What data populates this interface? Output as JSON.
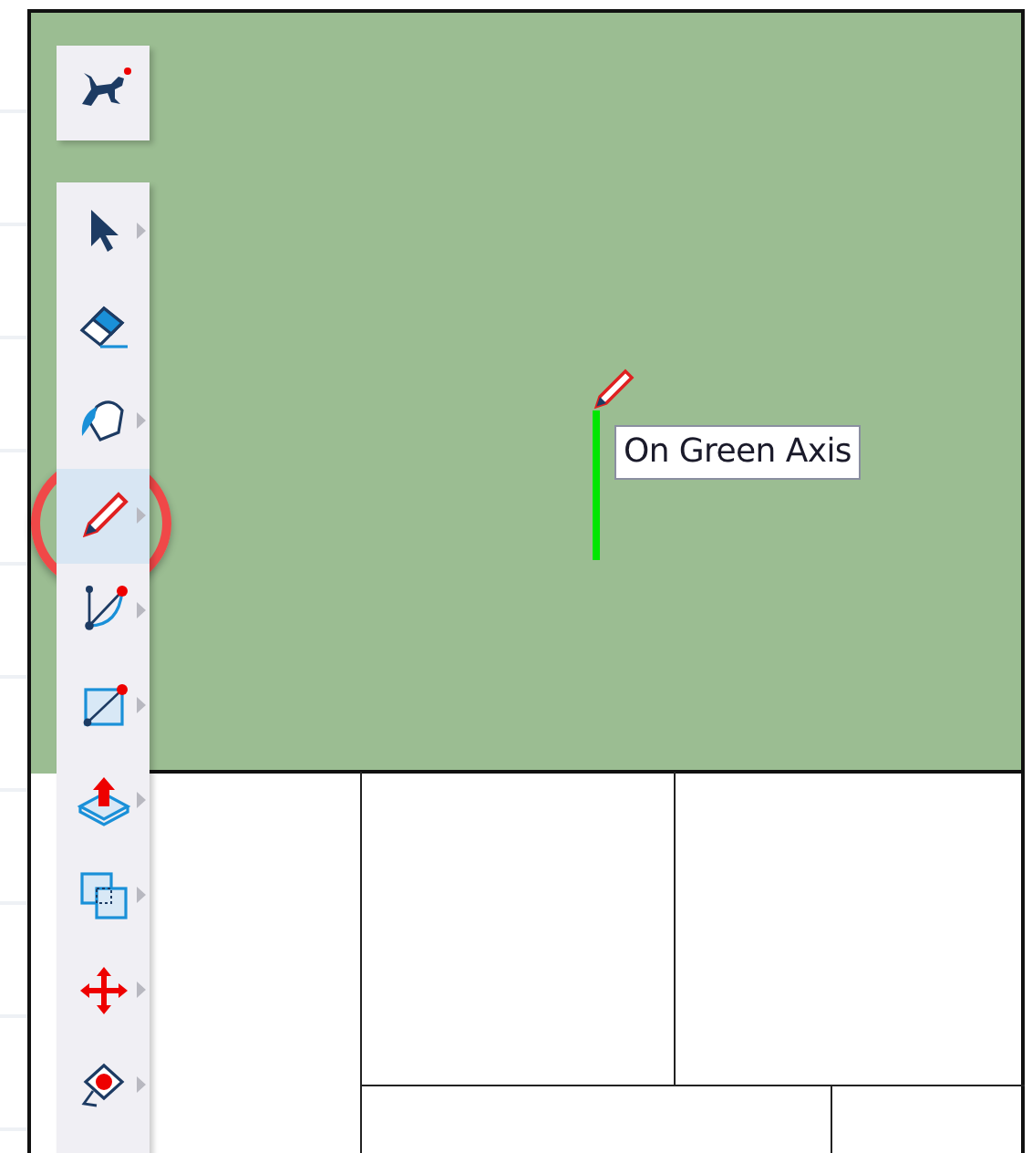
{
  "toolbar": {
    "logo": {
      "kind": "logo"
    },
    "tools": [
      {
        "kind": "select",
        "selected": false,
        "flyout": true
      },
      {
        "kind": "eraser",
        "selected": false,
        "flyout": false
      },
      {
        "kind": "paint",
        "selected": false,
        "flyout": true
      },
      {
        "kind": "pencil",
        "selected": true,
        "flyout": true
      },
      {
        "kind": "arc",
        "selected": false,
        "flyout": true
      },
      {
        "kind": "rectangle",
        "selected": false,
        "flyout": true
      },
      {
        "kind": "pushpull",
        "selected": false,
        "flyout": true
      },
      {
        "kind": "offset",
        "selected": false,
        "flyout": true
      },
      {
        "kind": "move",
        "selected": false,
        "flyout": true
      },
      {
        "kind": "tape",
        "selected": false,
        "flyout": true
      }
    ]
  },
  "viewport": {
    "tooltip": "On Green Axis"
  }
}
